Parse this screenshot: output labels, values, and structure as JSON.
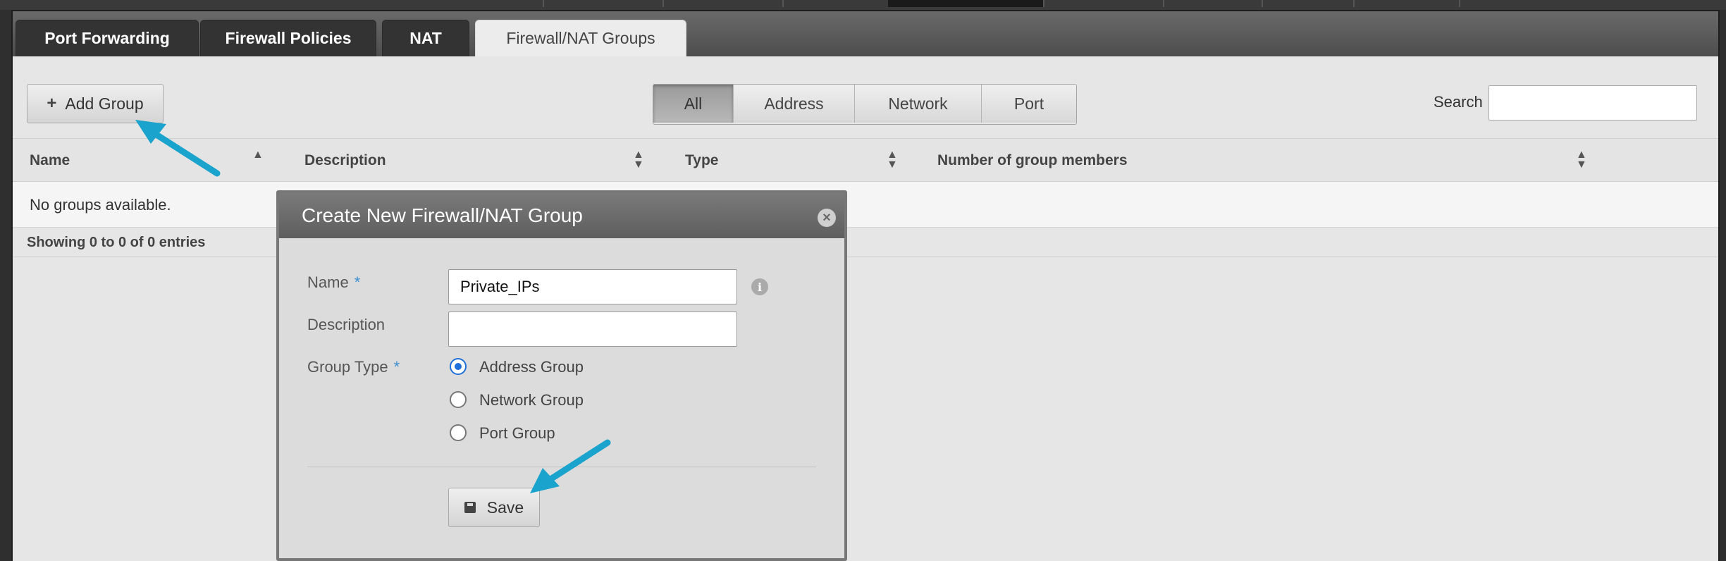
{
  "tabs": [
    {
      "label": "Port Forwarding",
      "active": false
    },
    {
      "label": "Firewall Policies",
      "active": false
    },
    {
      "label": "NAT",
      "active": false
    },
    {
      "label": "Firewall/NAT Groups",
      "active": true
    }
  ],
  "toolbar": {
    "add_group_label": "Add Group",
    "filters": [
      {
        "label": "All",
        "active": true
      },
      {
        "label": "Address",
        "active": false
      },
      {
        "label": "Network",
        "active": false
      },
      {
        "label": "Port",
        "active": false
      }
    ],
    "search_label": "Search",
    "search_value": ""
  },
  "table": {
    "columns": [
      "Name",
      "Description",
      "Type",
      "Number of group members"
    ],
    "empty_message": "No groups available.",
    "info": "Showing 0 to 0 of 0 entries"
  },
  "dialog": {
    "title": "Create New Firewall/NAT Group",
    "close_icon": "close-icon",
    "fields": {
      "name_label": "Name",
      "name_value": "Private_IPs",
      "description_label": "Description",
      "description_value": "",
      "group_type_label": "Group Type",
      "required_mark": "*"
    },
    "group_types": [
      {
        "label": "Address Group",
        "selected": true
      },
      {
        "label": "Network Group",
        "selected": false
      },
      {
        "label": "Port Group",
        "selected": false
      }
    ],
    "save_label": "Save"
  },
  "colors": {
    "accent": "#1e6fd9",
    "annotation_arrow": "#1aa3cc",
    "required": "#3b8fd0"
  }
}
